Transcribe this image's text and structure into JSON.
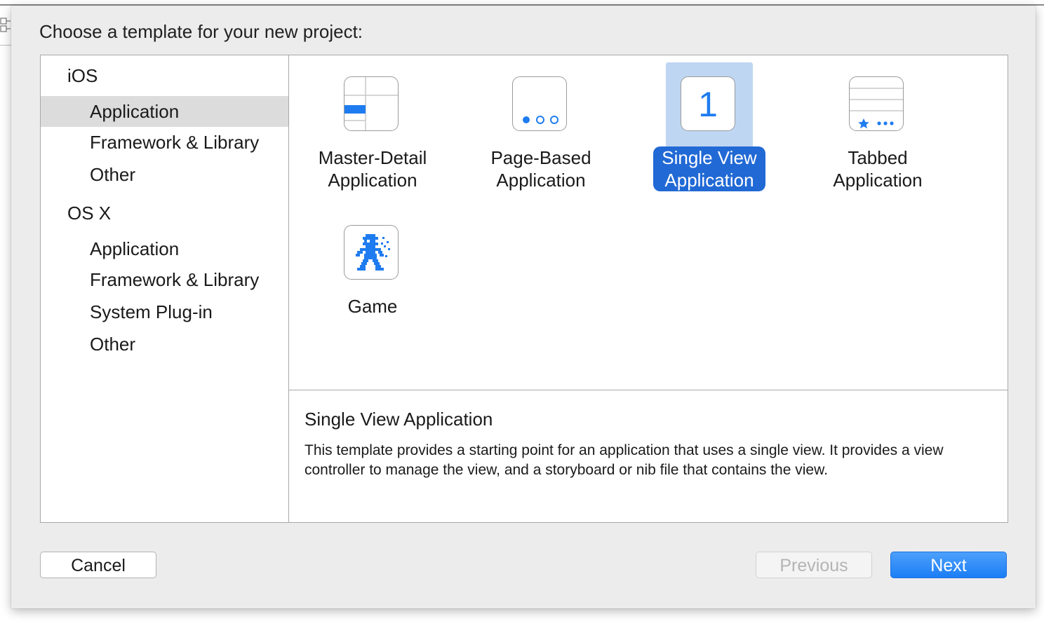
{
  "dialog": {
    "prompt": "Choose a template for your new project:"
  },
  "sidebar": {
    "sections": [
      {
        "label": "iOS",
        "items": [
          {
            "label": "Application",
            "selected": true
          },
          {
            "label": "Framework & Library",
            "selected": false
          },
          {
            "label": "Other",
            "selected": false
          }
        ]
      },
      {
        "label": "OS X",
        "items": [
          {
            "label": "Application",
            "selected": false
          },
          {
            "label": "Framework & Library",
            "selected": false
          },
          {
            "label": "System Plug-in",
            "selected": false
          },
          {
            "label": "Other",
            "selected": false
          }
        ]
      }
    ]
  },
  "templates": [
    {
      "line1": "Master-Detail",
      "line2": "Application",
      "icon": "master-detail-icon",
      "selected": false
    },
    {
      "line1": "Page-Based",
      "line2": "Application",
      "icon": "page-based-icon",
      "selected": false
    },
    {
      "line1": "Single View",
      "line2": "Application",
      "icon": "single-view-icon",
      "icon_text": "1",
      "selected": true
    },
    {
      "line1": "Tabbed",
      "line2": "Application",
      "icon": "tabbed-icon",
      "selected": false
    },
    {
      "line1": "Game",
      "line2": "",
      "icon": "game-icon",
      "selected": false
    }
  ],
  "description": {
    "title": "Single View Application",
    "body": "This template provides a starting point for an application that uses a single view. It provides a view controller to manage the view, and a storyboard or nib file that contains the view."
  },
  "buttons": {
    "cancel": "Cancel",
    "previous": "Previous",
    "previous_enabled": false,
    "next": "Next"
  },
  "colors": {
    "accent": "#2169d5",
    "icon_blue": "#1f7cf0",
    "selection_bg": "#bfd6f2",
    "sheet_bg": "#ececec"
  }
}
